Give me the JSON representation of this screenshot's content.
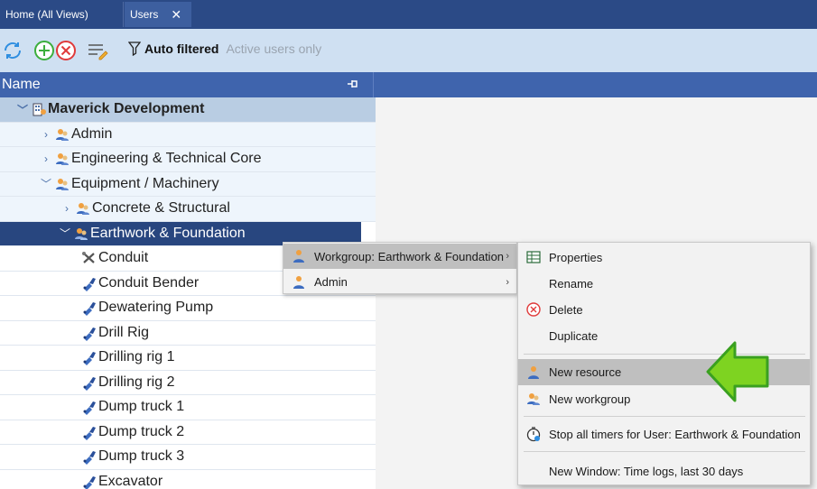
{
  "tabs": [
    {
      "label": "Home (All Views)"
    },
    {
      "label": "Users",
      "close": "✕"
    }
  ],
  "toolbar": {
    "filter_label": "Auto filtered",
    "filter_sub": "Active users only"
  },
  "header": {
    "name": "Name"
  },
  "tree": [
    {
      "label": "Maverick Development",
      "chev": "﹀",
      "icon": "building-icon"
    },
    {
      "label": "Admin",
      "chev": "›",
      "icon": "workgroup-icon"
    },
    {
      "label": "Engineering & Technical Core",
      "chev": "›",
      "icon": "workgroup-icon"
    },
    {
      "label": "Equipment / Machinery",
      "chev": "﹀",
      "icon": "workgroup-icon"
    },
    {
      "label": "Concrete & Structural",
      "chev": "›",
      "icon": "workgroup-icon"
    },
    {
      "label": "Earthwork & Foundation",
      "chev": "﹀",
      "icon": "workgroup-icon"
    },
    {
      "label": "Conduit",
      "icon": "tools-icon"
    },
    {
      "label": "Conduit Bender",
      "icon": "machine-icon"
    },
    {
      "label": "Dewatering Pump",
      "icon": "machine-icon"
    },
    {
      "label": "Drill Rig",
      "icon": "machine-icon"
    },
    {
      "label": "Drilling rig 1",
      "icon": "machine-icon"
    },
    {
      "label": "Drilling rig 2",
      "icon": "machine-icon"
    },
    {
      "label": "Dump truck 1",
      "icon": "machine-icon"
    },
    {
      "label": "Dump truck 2",
      "icon": "machine-icon"
    },
    {
      "label": "Dump truck 3",
      "icon": "machine-icon"
    },
    {
      "label": "Excavator",
      "icon": "machine-icon"
    }
  ],
  "menu1": [
    {
      "label": "Workgroup: Earthwork & Foundation",
      "arrow": "›"
    },
    {
      "label": "Admin",
      "arrow": "›"
    }
  ],
  "menu2": [
    {
      "label": "Properties"
    },
    {
      "label": "Rename"
    },
    {
      "label": "Delete"
    },
    {
      "label": "Duplicate"
    },
    {
      "label": "New resource"
    },
    {
      "label": "New workgroup"
    },
    {
      "label": "Stop all timers for User: Earthwork & Foundation"
    },
    {
      "label": "New Window: Time logs, last 30 days"
    }
  ],
  "colors": {
    "tab_bg": "#2b4a86",
    "toolbar_bg": "#cfe0f2",
    "header_bg": "#3f64ad",
    "selected_row": "#28467f",
    "highlight": "#bfbfbf",
    "arrow_green": "#7ed321"
  }
}
